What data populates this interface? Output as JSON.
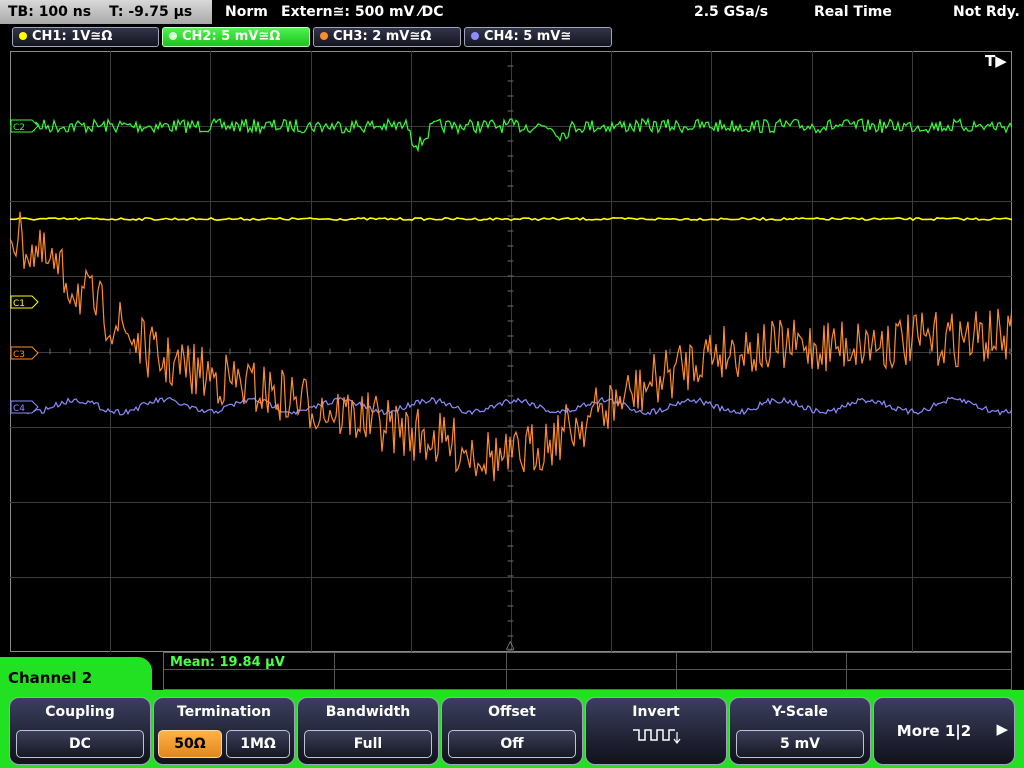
{
  "status_bar": {
    "timebase": "TB: 100 ns",
    "trigger_time": "T: -9.75 µs",
    "trigger_mode": "Norm",
    "trigger_source": "Extern≅: 500 mV ⁄DC",
    "sample_rate": "2.5 GSa/s",
    "acq_mode": "Real Time",
    "trigger_status": "Not Rdy."
  },
  "channels": [
    {
      "label": "CH1: 1V≅Ω",
      "color": "#ffff00",
      "marker": "C1"
    },
    {
      "label": "CH2: 5 mV≅Ω",
      "color": "#33ff33",
      "marker": "C2"
    },
    {
      "label": "CH3: 2 mV≅Ω",
      "color": "#ff8c2a",
      "marker": "C3"
    },
    {
      "label": "CH4: 5 mV≅",
      "color": "#8c8cff",
      "marker": "C4"
    }
  ],
  "trigger_marker": "T▶",
  "measurement": {
    "mean": "Mean: 19.84 µV"
  },
  "menu": {
    "title": "Channel 2",
    "coupling": {
      "title": "Coupling",
      "value": "DC"
    },
    "termination": {
      "title": "Termination",
      "option_a": "50Ω",
      "option_b": "1MΩ",
      "selected": "50Ω"
    },
    "bandwidth": {
      "title": "Bandwidth",
      "value": "Full"
    },
    "offset": {
      "title": "Offset",
      "value": "Off"
    },
    "invert": {
      "title": "Invert"
    },
    "yscale": {
      "title": "Y-Scale",
      "value": "5 mV"
    },
    "more": {
      "label": "More 1|2",
      "arrow": "▶"
    }
  },
  "colors": {
    "ch1": "#ffff00",
    "ch2": "#33ff33",
    "ch3": "#ff8c2a",
    "ch4": "#8c8cff",
    "accent_green": "#22e022",
    "selected_orange": "#f0a030"
  }
}
